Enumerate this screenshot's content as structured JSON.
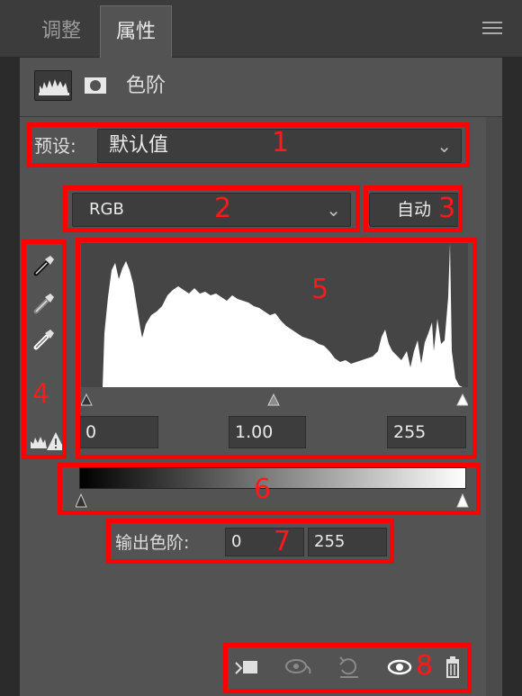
{
  "tabs": [
    {
      "label": "调整",
      "active": false
    },
    {
      "label": "属性",
      "active": true
    }
  ],
  "panel": {
    "type_label": "色阶",
    "preset_label": "预设:",
    "preset_value": "默认值",
    "channel_value": "RGB",
    "auto_label": "自动",
    "input_levels": {
      "black": "0",
      "gamma": "1.00",
      "white": "255"
    },
    "output_label": "输出色阶:",
    "output_levels": {
      "black": "0",
      "white": "255"
    }
  },
  "annotations": [
    "1",
    "2",
    "3",
    "4",
    "5",
    "6",
    "7",
    "8"
  ],
  "icons": [
    "menu-icon",
    "histogram-icon",
    "mask-icon",
    "black-eyedropper-icon",
    "gray-eyedropper-icon",
    "white-eyedropper-icon",
    "clipping-warning-icon",
    "clip-to-layer-icon",
    "view-previous-icon",
    "reset-icon",
    "visibility-icon",
    "delete-icon"
  ],
  "colors": {
    "panel": "#535353",
    "annotation": "#ff0000"
  }
}
